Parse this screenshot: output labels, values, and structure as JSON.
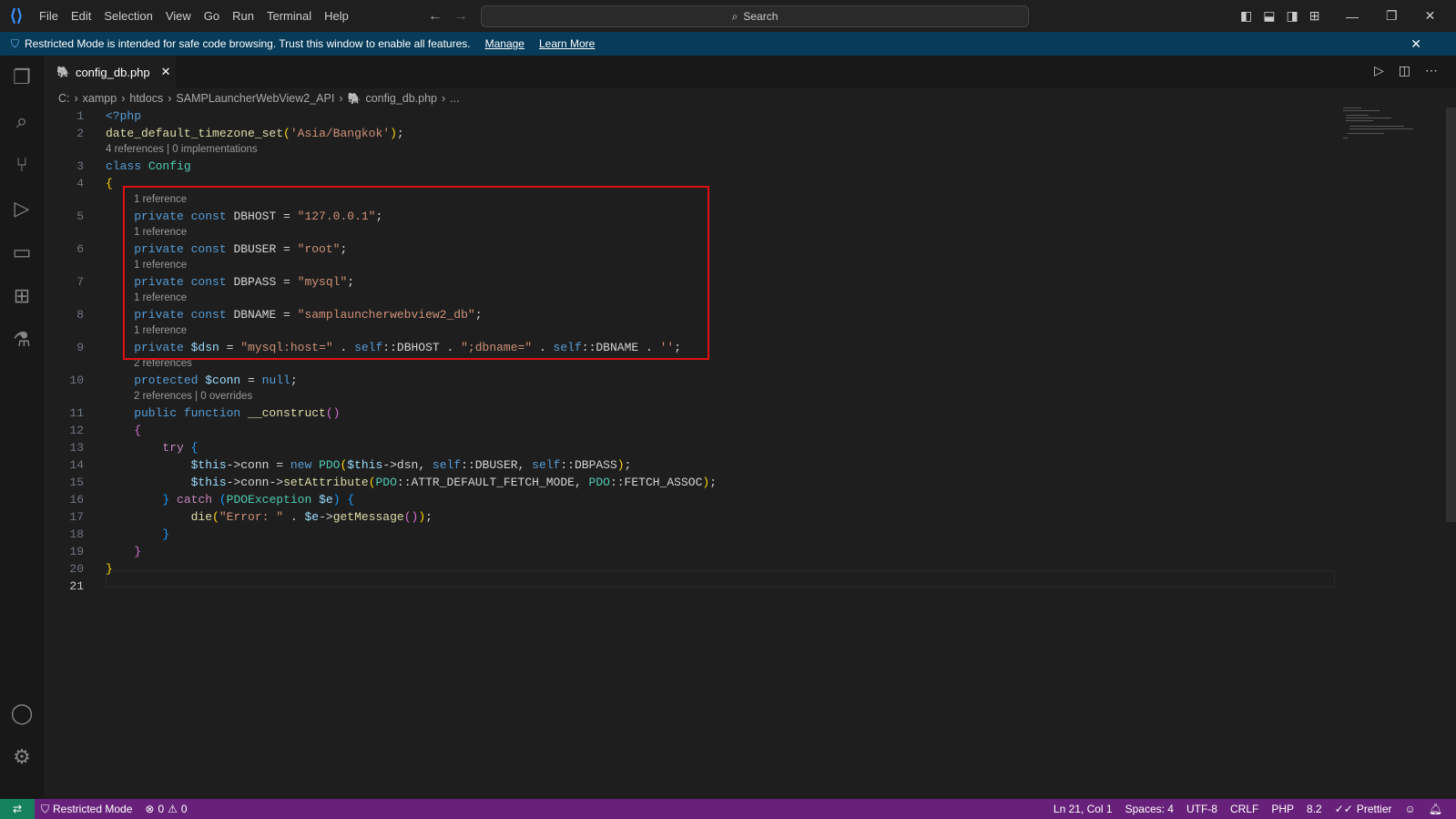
{
  "titlebar": {
    "menu": [
      "File",
      "Edit",
      "Selection",
      "View",
      "Go",
      "Run",
      "Terminal",
      "Help"
    ],
    "search": "Search"
  },
  "banner": {
    "text": "Restricted Mode is intended for safe code browsing. Trust this window to enable all features.",
    "manage": "Manage",
    "learn_more": "Learn More"
  },
  "tab": {
    "label": "config_db.php"
  },
  "breadcrumbs": [
    "C:",
    "xampp",
    "htdocs",
    "SAMPLauncherWebView2_API",
    "config_db.php",
    "..."
  ],
  "code": [
    {
      "n": "1",
      "t": [
        [
          "<?php",
          "kw"
        ]
      ]
    },
    {
      "n": "2",
      "t": [
        [
          "date_default_timezone_set",
          "fn"
        ],
        [
          "(",
          "b1"
        ],
        [
          "'Asia/Bangkok'",
          "str"
        ],
        [
          ")",
          "b1"
        ],
        [
          ";",
          "pl"
        ]
      ]
    },
    {
      "lens": "4 references | 0 implementations",
      "i": 0
    },
    {
      "n": "3",
      "t": [
        [
          "class ",
          "kw"
        ],
        [
          "Config",
          "cls"
        ]
      ]
    },
    {
      "n": "4",
      "t": [
        [
          "{",
          "b1"
        ]
      ]
    },
    {
      "lens": "1 reference",
      "i": 1
    },
    {
      "n": "5",
      "t": [
        [
          "    private const ",
          "kw"
        ],
        [
          "DBHOST = ",
          "pl"
        ],
        [
          "\"127.0.0.1\"",
          "str"
        ],
        [
          ";",
          "pl"
        ]
      ]
    },
    {
      "lens": "1 reference",
      "i": 1
    },
    {
      "n": "6",
      "t": [
        [
          "    private const ",
          "kw"
        ],
        [
          "DBUSER = ",
          "pl"
        ],
        [
          "\"root\"",
          "str"
        ],
        [
          ";",
          "pl"
        ]
      ]
    },
    {
      "lens": "1 reference",
      "i": 1
    },
    {
      "n": "7",
      "t": [
        [
          "    private const ",
          "kw"
        ],
        [
          "DBPASS = ",
          "pl"
        ],
        [
          "\"mysql\"",
          "str"
        ],
        [
          ";",
          "pl"
        ]
      ]
    },
    {
      "lens": "1 reference",
      "i": 1
    },
    {
      "n": "8",
      "t": [
        [
          "    private const ",
          "kw"
        ],
        [
          "DBNAME = ",
          "pl"
        ],
        [
          "\"samplauncherwebview2_db\"",
          "str"
        ],
        [
          ";",
          "pl"
        ]
      ]
    },
    {
      "lens": "1 reference",
      "i": 1
    },
    {
      "n": "9",
      "t": [
        [
          "    private ",
          "kw"
        ],
        [
          "$dsn",
          "var"
        ],
        [
          " = ",
          "pl"
        ],
        [
          "\"mysql:host=\"",
          "str"
        ],
        [
          " . ",
          "pl"
        ],
        [
          "self",
          "kw"
        ],
        [
          "::DBHOST . ",
          "pl"
        ],
        [
          "\";dbname=\"",
          "str"
        ],
        [
          " . ",
          "pl"
        ],
        [
          "self",
          "kw"
        ],
        [
          "::DBNAME . ",
          "pl"
        ],
        [
          "''",
          "str"
        ],
        [
          ";",
          "pl"
        ]
      ]
    },
    {
      "lens": "2 references",
      "i": 1
    },
    {
      "n": "10",
      "t": [
        [
          "    protected ",
          "kw"
        ],
        [
          "$conn",
          "var"
        ],
        [
          " = ",
          "pl"
        ],
        [
          "null",
          "kw"
        ],
        [
          ";",
          "pl"
        ]
      ]
    },
    {
      "lens": "2 references | 0 overrides",
      "i": 1
    },
    {
      "n": "11",
      "t": [
        [
          "    public function ",
          "kw"
        ],
        [
          "__construct",
          "fn"
        ],
        [
          "()",
          "b2"
        ]
      ]
    },
    {
      "n": "12",
      "t": [
        [
          "    ",
          "pl"
        ],
        [
          "{",
          "b2"
        ]
      ]
    },
    {
      "n": "13",
      "t": [
        [
          "        try ",
          "ctl"
        ],
        [
          "{",
          "b3"
        ]
      ]
    },
    {
      "n": "14",
      "t": [
        [
          "            ",
          "pl"
        ],
        [
          "$this",
          "var"
        ],
        [
          "->conn = ",
          "pl"
        ],
        [
          "new ",
          "kw"
        ],
        [
          "PDO",
          "cls"
        ],
        [
          "(",
          "b1"
        ],
        [
          "$this",
          "var"
        ],
        [
          "->dsn, ",
          "pl"
        ],
        [
          "self",
          "kw"
        ],
        [
          "::DBUSER, ",
          "pl"
        ],
        [
          "self",
          "kw"
        ],
        [
          "::DBPASS",
          "pl"
        ],
        [
          ")",
          "b1"
        ],
        [
          ";",
          "pl"
        ]
      ]
    },
    {
      "n": "15",
      "t": [
        [
          "            ",
          "pl"
        ],
        [
          "$this",
          "var"
        ],
        [
          "->conn->",
          "pl"
        ],
        [
          "setAttribute",
          "fn"
        ],
        [
          "(",
          "b1"
        ],
        [
          "PDO",
          "cls"
        ],
        [
          "::ATTR_DEFAULT_FETCH_MODE, ",
          "pl"
        ],
        [
          "PDO",
          "cls"
        ],
        [
          "::FETCH_ASSOC",
          "pl"
        ],
        [
          ")",
          "b1"
        ],
        [
          ";",
          "pl"
        ]
      ]
    },
    {
      "n": "16",
      "t": [
        [
          "        ",
          "pl"
        ],
        [
          "}",
          "b3"
        ],
        [
          " catch ",
          "ctl"
        ],
        [
          "(",
          "b3"
        ],
        [
          "PDOException ",
          "cls"
        ],
        [
          "$e",
          "var"
        ],
        [
          ")",
          "b3"
        ],
        [
          " ",
          "pl"
        ],
        [
          "{",
          "b3"
        ]
      ]
    },
    {
      "n": "17",
      "t": [
        [
          "            die",
          "fn"
        ],
        [
          "(",
          "b1"
        ],
        [
          "\"Error: \"",
          "str"
        ],
        [
          " . ",
          "pl"
        ],
        [
          "$e",
          "var"
        ],
        [
          "->",
          "pl"
        ],
        [
          "getMessage",
          "fn"
        ],
        [
          "()",
          "b2"
        ],
        [
          ")",
          "b1"
        ],
        [
          ";",
          "pl"
        ]
      ]
    },
    {
      "n": "18",
      "t": [
        [
          "        ",
          "pl"
        ],
        [
          "}",
          "b3"
        ]
      ]
    },
    {
      "n": "19",
      "t": [
        [
          "    ",
          "pl"
        ],
        [
          "}",
          "b2"
        ]
      ]
    },
    {
      "n": "20",
      "t": [
        [
          "}",
          "b1"
        ]
      ]
    },
    {
      "n": "21",
      "t": []
    }
  ],
  "status": {
    "mode": "Restricted Mode",
    "errors": "0",
    "warnings": "0",
    "position": "Ln 21, Col 1",
    "spaces": "Spaces: 4",
    "encoding": "UTF-8",
    "eol": "CRLF",
    "language": "PHP",
    "version": "8.2",
    "formatter": "Prettier"
  }
}
